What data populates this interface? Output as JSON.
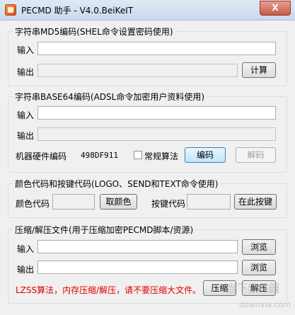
{
  "window": {
    "title": "PECMD 助手 - V4.0.BeiKeIT",
    "close_label": "X"
  },
  "md5": {
    "legend": "字符串MD5编码(SHEL命令设置密码使用)",
    "input_label": "输入",
    "input_value": "",
    "output_label": "输出",
    "output_value": "",
    "calc_button": "计算"
  },
  "base64": {
    "legend": "字符串BASE64编码(ADSL命令加密用户资料使用)",
    "input_label": "输入",
    "input_value": "",
    "output_label": "输出",
    "output_value": "",
    "hw_label": "机器硬件编码",
    "hw_value": "498DF911",
    "normal_algo_label": "常规算法",
    "normal_algo_checked": false,
    "encode_button": "编码",
    "decode_button": "解码"
  },
  "keycodes": {
    "legend": "颜色代码和按键代码(LOGO、SEND和TEXT命令使用)",
    "color_label": "颜色代码",
    "color_value": "",
    "pick_color_button": "取颜色",
    "key_label": "按键代码",
    "key_value": "",
    "press_key_button": "在此按键"
  },
  "compress": {
    "legend": "压缩/解压文件(用于压缩加密PECMD脚本/资源)",
    "input_label": "输入",
    "input_value": "",
    "output_label": "输出",
    "output_value": "",
    "browse_in_button": "浏览",
    "browse_out_button": "浏览",
    "warning": "LZSS算法，内存压缩/解压，请不要压缩大文件。",
    "compress_button": "压缩",
    "decompress_button": "解压"
  },
  "watermark": {
    "text": "当下软件园",
    "url": "downxia.com"
  }
}
